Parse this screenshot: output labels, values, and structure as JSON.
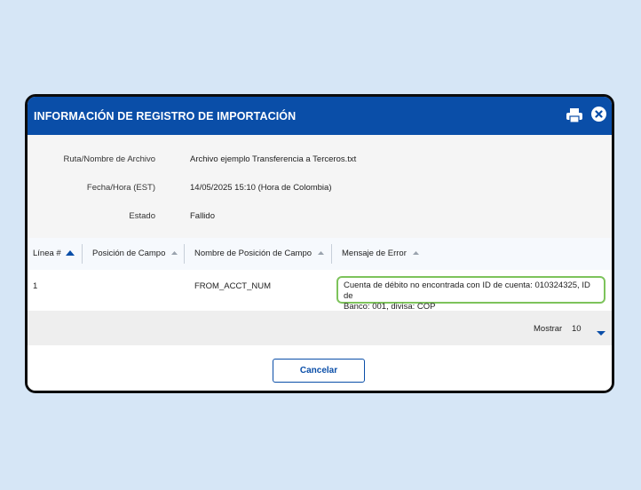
{
  "modal": {
    "title": "INFORMACIÓN DE REGISTRO DE IMPORTACIÓN",
    "accent_color": "#0a4ea8",
    "icons": [
      "printer-icon",
      "close-icon"
    ]
  },
  "info": {
    "file_label": "Ruta/Nombre de Archivo",
    "file_value": "Archivo ejemplo Transferencia a Terceros.txt",
    "datetime_label": "Fecha/Hora (EST)",
    "datetime_value": "14/05/2025 15:10 (Hora de Colombia)",
    "status_label": "Estado",
    "status_value": "Fallido"
  },
  "table": {
    "columns": [
      "Línea #",
      "Posición de Campo",
      "Nombre de Posición de Campo",
      "Mensaje de Error"
    ],
    "rows": [
      {
        "line": "1",
        "field_position": "",
        "field_name": "FROM_ACCT_NUM",
        "error_line1": "Cuenta de débito no encontrada con ID de cuenta: 010324325, ID de",
        "error_line2": "Banco: 001, divisa: COP"
      }
    ]
  },
  "pager": {
    "show_label": "Mostrar",
    "page_size": "10"
  },
  "footer": {
    "cancel_label": "Cancelar"
  }
}
